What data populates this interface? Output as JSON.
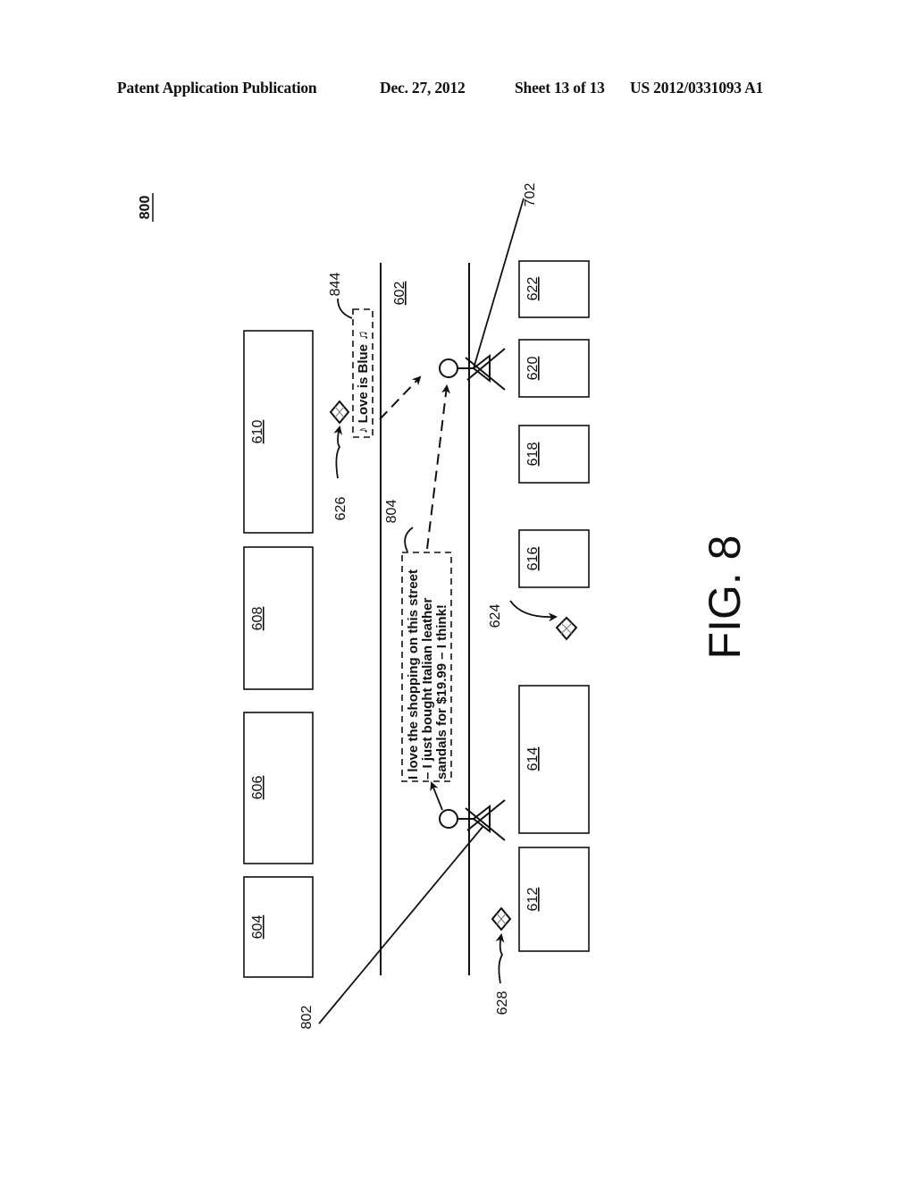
{
  "header": {
    "publication": "Patent Application Publication",
    "date": "Dec. 27, 2012",
    "sheet": "Sheet 13 of 13",
    "number": "US 2012/0331093 A1"
  },
  "figure": {
    "id": "800",
    "caption": "FIG. 8",
    "street_label": "602",
    "buildings_top_row": [
      "604",
      "606",
      "608",
      "610"
    ],
    "buildings_bottom_row": [
      "612",
      "614",
      "616",
      "618",
      "620",
      "622"
    ],
    "users": [
      {
        "ref": "802",
        "name": "user-802"
      },
      {
        "ref": "702",
        "name": "user-702"
      }
    ],
    "kites": [
      {
        "ref": "624"
      },
      {
        "ref": "626"
      },
      {
        "ref": "628"
      }
    ],
    "messages": [
      {
        "ref": "804",
        "lines": [
          "I love the shopping on this street",
          "– I just bought Italian leather",
          "sandals for $19.99 – I think!"
        ]
      },
      {
        "ref": "844",
        "text": "♪ Love is Blue ♫"
      }
    ]
  }
}
